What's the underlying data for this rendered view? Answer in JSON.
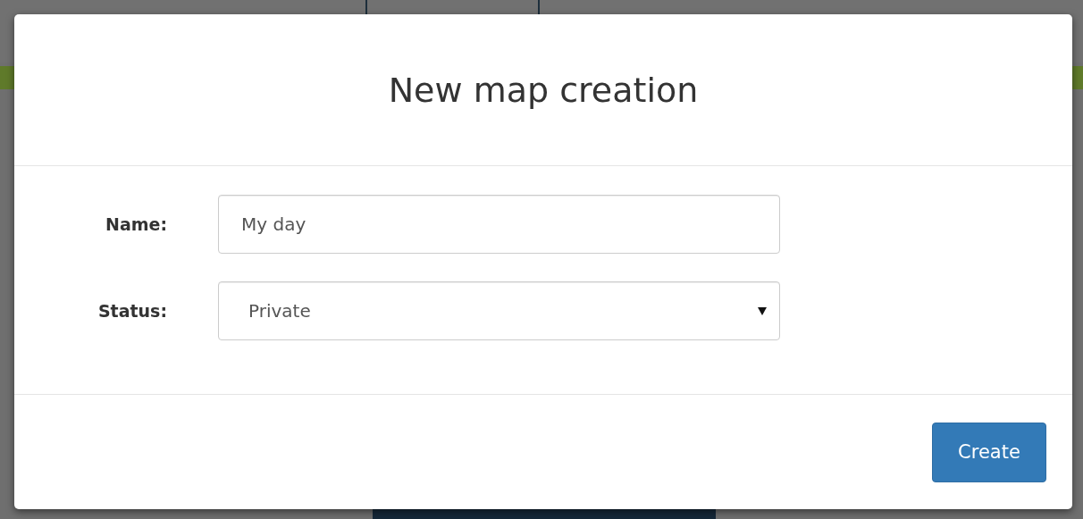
{
  "dialog": {
    "title": "New map creation",
    "fields": [
      {
        "kind": "text",
        "label": "Name:",
        "value": "My day"
      },
      {
        "kind": "select",
        "label": "Status:",
        "value": "Private"
      }
    ],
    "buttons": [
      {
        "label": "Create"
      }
    ]
  }
}
